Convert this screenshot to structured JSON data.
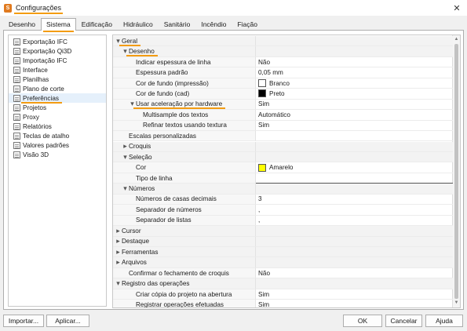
{
  "window": {
    "title": "Configurações",
    "app_icon": "S"
  },
  "tabs": [
    {
      "label": "Desenho"
    },
    {
      "label": "Sistema",
      "active": true
    },
    {
      "label": "Edificação"
    },
    {
      "label": "Hidráulico"
    },
    {
      "label": "Sanitário"
    },
    {
      "label": "Incêndio"
    },
    {
      "label": "Fiação"
    }
  ],
  "sidebar": {
    "items": [
      {
        "label": "Exportação IFC"
      },
      {
        "label": "Exportação Qi3D"
      },
      {
        "label": "Importação IFC"
      },
      {
        "label": "Interface"
      },
      {
        "label": "Planilhas"
      },
      {
        "label": "Plano de corte"
      },
      {
        "label": "Preferências",
        "selected": true
      },
      {
        "label": "Projetos"
      },
      {
        "label": "Proxy"
      },
      {
        "label": "Relatórios"
      },
      {
        "label": "Teclas de atalho"
      },
      {
        "label": "Valores padrões"
      },
      {
        "label": "Visão 3D"
      }
    ]
  },
  "properties": {
    "rows": [
      {
        "name": "Geral",
        "value": "",
        "level": 0,
        "toggle": "down",
        "type": "cat",
        "highlight": true
      },
      {
        "name": "Desenho",
        "value": "",
        "level": 1,
        "toggle": "down",
        "type": "cat",
        "highlight": true
      },
      {
        "name": "Indicar espessura de linha",
        "value": "Não",
        "level": 2,
        "type": "prop"
      },
      {
        "name": "Espessura padrão",
        "value": "0,05 mm",
        "level": 2,
        "type": "prop"
      },
      {
        "name": "Cor de fundo (impressão)",
        "value": "Branco",
        "level": 2,
        "type": "prop",
        "swatch": "#ffffff"
      },
      {
        "name": "Cor de fundo (cad)",
        "value": "Preto",
        "level": 2,
        "type": "prop",
        "swatch": "#000000"
      },
      {
        "name": "Usar aceleração por hardware",
        "value": "Sim",
        "level": 2,
        "toggle": "down",
        "type": "prop",
        "highlight": true
      },
      {
        "name": "Multisample dos textos",
        "value": "Automático",
        "level": 3,
        "type": "prop"
      },
      {
        "name": "Refinar textos usando textura",
        "value": "Sim",
        "level": 3,
        "type": "prop"
      },
      {
        "name": "Escalas personalizadas",
        "value": "",
        "level": 1,
        "type": "prop"
      },
      {
        "name": "Croquis",
        "value": "",
        "level": 1,
        "toggle": "right",
        "type": "cat"
      },
      {
        "name": "Seleção",
        "value": "",
        "level": 1,
        "toggle": "down",
        "type": "cat"
      },
      {
        "name": "Cor",
        "value": "Amarelo",
        "level": 2,
        "type": "prop",
        "swatch": "#ffff00"
      },
      {
        "name": "Tipo de linha",
        "value": "",
        "level": 2,
        "type": "prop",
        "lined": true
      },
      {
        "name": "Números",
        "value": "",
        "level": 1,
        "toggle": "down",
        "type": "cat"
      },
      {
        "name": "Números de casas decimais",
        "value": "3",
        "level": 2,
        "type": "prop"
      },
      {
        "name": "Separador de números",
        "value": ",",
        "level": 2,
        "type": "prop"
      },
      {
        "name": "Separador de listas",
        "value": ",",
        "level": 2,
        "type": "prop"
      },
      {
        "name": "Cursor",
        "value": "",
        "level": 0,
        "toggle": "right",
        "type": "cat"
      },
      {
        "name": "Destaque",
        "value": "",
        "level": 0,
        "toggle": "right",
        "type": "cat"
      },
      {
        "name": "Ferramentas",
        "value": "",
        "level": 0,
        "toggle": "right",
        "type": "cat"
      },
      {
        "name": "Arquivos",
        "value": "",
        "level": 0,
        "toggle": "right",
        "type": "cat"
      },
      {
        "name": "Confirmar o fechamento de croquis",
        "value": "Não",
        "level": 1,
        "type": "prop"
      },
      {
        "name": "Registro das operações",
        "value": "",
        "level": 0,
        "toggle": "down",
        "type": "cat"
      },
      {
        "name": "Criar cópia do projeto na abertura",
        "value": "Sim",
        "level": 2,
        "type": "prop"
      },
      {
        "name": "Registrar operações efetuadas",
        "value": "Sim",
        "level": 2,
        "type": "prop"
      }
    ]
  },
  "buttons": {
    "import": "Importar...",
    "apply": "Aplicar...",
    "ok": "OK",
    "cancel": "Cancelar",
    "help": "Ajuda"
  },
  "colors": {
    "accent_underline": "#f39c12",
    "selection_yellow": "#ffff00"
  }
}
